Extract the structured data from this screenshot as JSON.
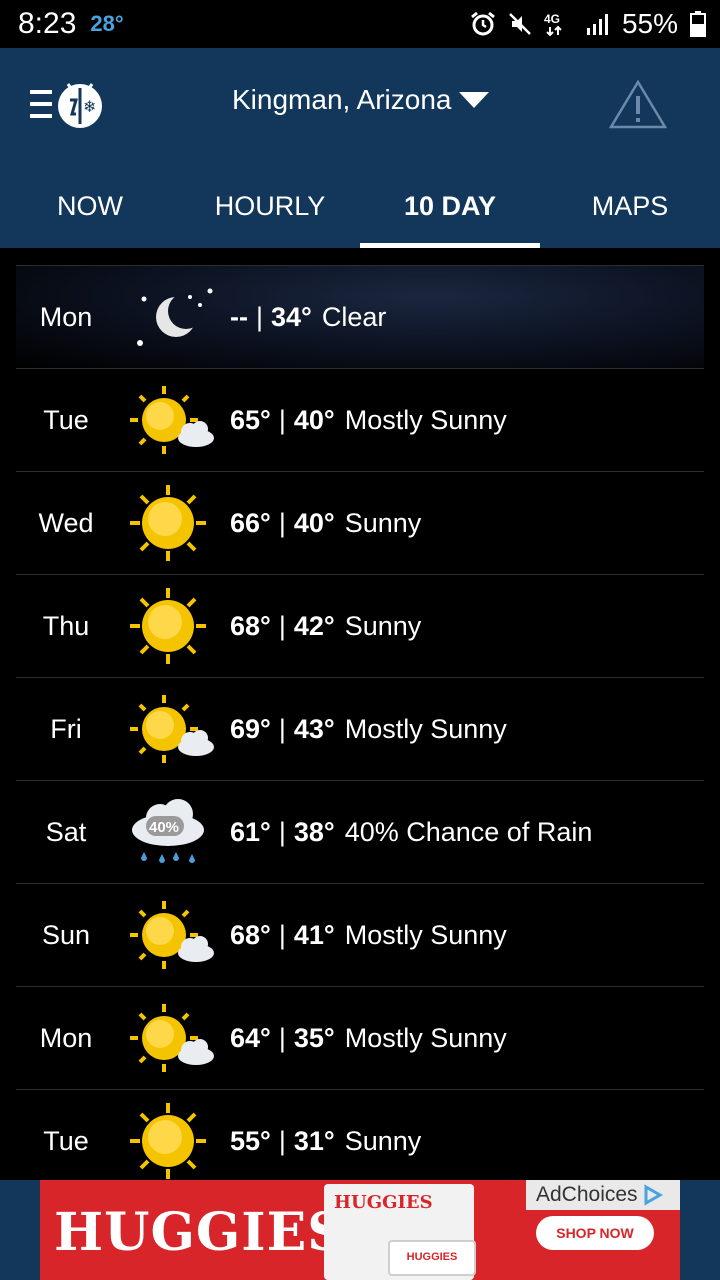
{
  "status_bar": {
    "time": "8:23",
    "temperature": "28°",
    "battery_percent": "55%"
  },
  "header": {
    "location": "Kingman, Arizona"
  },
  "tabs": [
    {
      "label": "NOW",
      "active": false
    },
    {
      "label": "HOURLY",
      "active": false
    },
    {
      "label": "10 DAY",
      "active": true
    },
    {
      "label": "MAPS",
      "active": false
    }
  ],
  "forecast": [
    {
      "day": "Mon",
      "icon": "moon-clear-icon",
      "high": "--",
      "low": "34°",
      "condition": "Clear"
    },
    {
      "day": "Tue",
      "icon": "mostly-sunny-icon",
      "high": "65°",
      "low": "40°",
      "condition": "Mostly Sunny"
    },
    {
      "day": "Wed",
      "icon": "sunny-icon",
      "high": "66°",
      "low": "40°",
      "condition": "Sunny"
    },
    {
      "day": "Thu",
      "icon": "sunny-icon",
      "high": "68°",
      "low": "42°",
      "condition": "Sunny"
    },
    {
      "day": "Fri",
      "icon": "mostly-sunny-icon",
      "high": "69°",
      "low": "43°",
      "condition": "Mostly Sunny"
    },
    {
      "day": "Sat",
      "icon": "rain-chance-icon",
      "icon_label": "40%",
      "high": "61°",
      "low": "38°",
      "condition": "40% Chance of Rain"
    },
    {
      "day": "Sun",
      "icon": "mostly-sunny-icon",
      "high": "68°",
      "low": "41°",
      "condition": "Mostly Sunny"
    },
    {
      "day": "Mon",
      "icon": "mostly-sunny-icon",
      "high": "64°",
      "low": "35°",
      "condition": "Mostly Sunny"
    },
    {
      "day": "Tue",
      "icon": "sunny-icon",
      "high": "55°",
      "low": "31°",
      "condition": "Sunny"
    }
  ],
  "ad": {
    "brand": "HUGGIES",
    "product_logo": "HUGGIES",
    "wipes_label": "HUGGIES",
    "adchoices": "AdChoices",
    "cta": "SHOP NOW"
  },
  "colors": {
    "header_bg": "#12375b",
    "status_temp": "#4aa3df",
    "ad_bg": "#d8252a",
    "sun": "#f5c400"
  }
}
